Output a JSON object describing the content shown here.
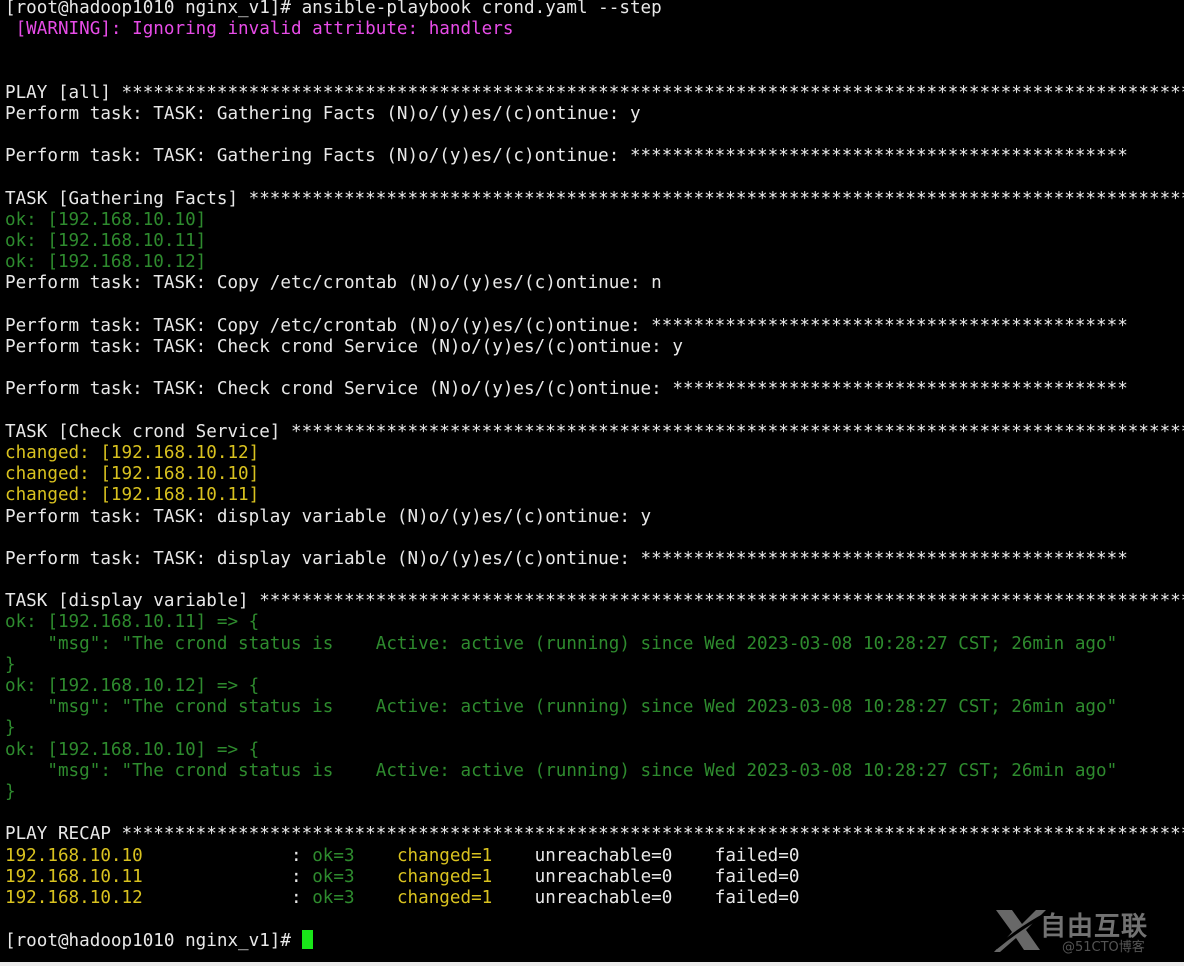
{
  "colors": {
    "background": "#000000",
    "default_text": "#e8e8e8",
    "warning": "#e84ce8",
    "ok": "#2e8b2e",
    "changed": "#d9c21f",
    "cursor": "#19e619"
  },
  "terminal": {
    "lines": [
      [
        {
          "t": "[root@hadoop1010 nginx_v1]# ansible-playbook crond.yaml --step",
          "c": "white"
        }
      ],
      [
        {
          "t": " [WARNING]: Ignoring invalid attribute: handlers",
          "c": "magenta"
        }
      ],
      [],
      [],
      [
        {
          "t": "PLAY [all] *****************************************************************************************************",
          "c": "white"
        }
      ],
      [
        {
          "t": "Perform task: TASK: Gathering Facts (N)o/(y)es/(c)ontinue: y",
          "c": "white"
        }
      ],
      [],
      [
        {
          "t": "Perform task: TASK: Gathering Facts (N)o/(y)es/(c)ontinue: ***********************************************",
          "c": "white"
        }
      ],
      [],
      [
        {
          "t": "TASK [Gathering Facts] *****************************************************************************************",
          "c": "white"
        }
      ],
      [
        {
          "t": "ok: [192.168.10.10]",
          "c": "green"
        }
      ],
      [
        {
          "t": "ok: [192.168.10.11]",
          "c": "green"
        }
      ],
      [
        {
          "t": "ok: [192.168.10.12]",
          "c": "green"
        }
      ],
      [
        {
          "t": "Perform task: TASK: Copy /etc/crontab (N)o/(y)es/(c)ontinue: n",
          "c": "white"
        }
      ],
      [],
      [
        {
          "t": "Perform task: TASK: Copy /etc/crontab (N)o/(y)es/(c)ontinue: *********************************************",
          "c": "white"
        }
      ],
      [
        {
          "t": "Perform task: TASK: Check crond Service (N)o/(y)es/(c)ontinue: y",
          "c": "white"
        }
      ],
      [],
      [
        {
          "t": "Perform task: TASK: Check crond Service (N)o/(y)es/(c)ontinue: *******************************************",
          "c": "white"
        }
      ],
      [],
      [
        {
          "t": "TASK [Check crond Service] *************************************************************************************",
          "c": "white"
        }
      ],
      [
        {
          "t": "changed: [192.168.10.12]",
          "c": "yellow"
        }
      ],
      [
        {
          "t": "changed: [192.168.10.10]",
          "c": "yellow"
        }
      ],
      [
        {
          "t": "changed: [192.168.10.11]",
          "c": "yellow"
        }
      ],
      [
        {
          "t": "Perform task: TASK: display variable (N)o/(y)es/(c)ontinue: y",
          "c": "white"
        }
      ],
      [],
      [
        {
          "t": "Perform task: TASK: display variable (N)o/(y)es/(c)ontinue: **********************************************",
          "c": "white"
        }
      ],
      [],
      [
        {
          "t": "TASK [display variable] ****************************************************************************************",
          "c": "white"
        }
      ],
      [
        {
          "t": "ok: [192.168.10.11] => {",
          "c": "green"
        }
      ],
      [
        {
          "t": "    \"msg\": \"The crond status is    Active: active (running) since Wed 2023-03-08 10:28:27 CST; 26min ago\"",
          "c": "green"
        }
      ],
      [
        {
          "t": "}",
          "c": "green"
        }
      ],
      [
        {
          "t": "ok: [192.168.10.12] => {",
          "c": "green"
        }
      ],
      [
        {
          "t": "    \"msg\": \"The crond status is    Active: active (running) since Wed 2023-03-08 10:28:27 CST; 26min ago\"",
          "c": "green"
        }
      ],
      [
        {
          "t": "}",
          "c": "green"
        }
      ],
      [
        {
          "t": "ok: [192.168.10.10] => {",
          "c": "green"
        }
      ],
      [
        {
          "t": "    \"msg\": \"The crond status is    Active: active (running) since Wed 2023-03-08 10:28:27 CST; 26min ago\"",
          "c": "green"
        }
      ],
      [
        {
          "t": "}",
          "c": "green"
        }
      ],
      [],
      [
        {
          "t": "PLAY RECAP *****************************************************************************************************",
          "c": "white"
        }
      ],
      [
        {
          "t": "192.168.10.10",
          "c": "yellow"
        },
        {
          "t": "              : ",
          "c": "white"
        },
        {
          "t": "ok=3",
          "c": "green"
        },
        {
          "t": "    ",
          "c": "white"
        },
        {
          "t": "changed=1",
          "c": "yellow"
        },
        {
          "t": "    unreachable=0    failed=0",
          "c": "white"
        }
      ],
      [
        {
          "t": "192.168.10.11",
          "c": "yellow"
        },
        {
          "t": "              : ",
          "c": "white"
        },
        {
          "t": "ok=3",
          "c": "green"
        },
        {
          "t": "    ",
          "c": "white"
        },
        {
          "t": "changed=1",
          "c": "yellow"
        },
        {
          "t": "    unreachable=0    failed=0",
          "c": "white"
        }
      ],
      [
        {
          "t": "192.168.10.12",
          "c": "yellow"
        },
        {
          "t": "              : ",
          "c": "white"
        },
        {
          "t": "ok=3",
          "c": "green"
        },
        {
          "t": "    ",
          "c": "white"
        },
        {
          "t": "changed=1",
          "c": "yellow"
        },
        {
          "t": "    unreachable=0    failed=0",
          "c": "white"
        }
      ],
      [],
      [
        {
          "t": "[root@hadoop1010 nginx_v1]# ",
          "c": "white"
        },
        {
          "cursor": true
        }
      ]
    ]
  },
  "watermark": {
    "brand": "自由互联",
    "sub": "@51CTO博客",
    "icon": "x-logo-icon"
  }
}
